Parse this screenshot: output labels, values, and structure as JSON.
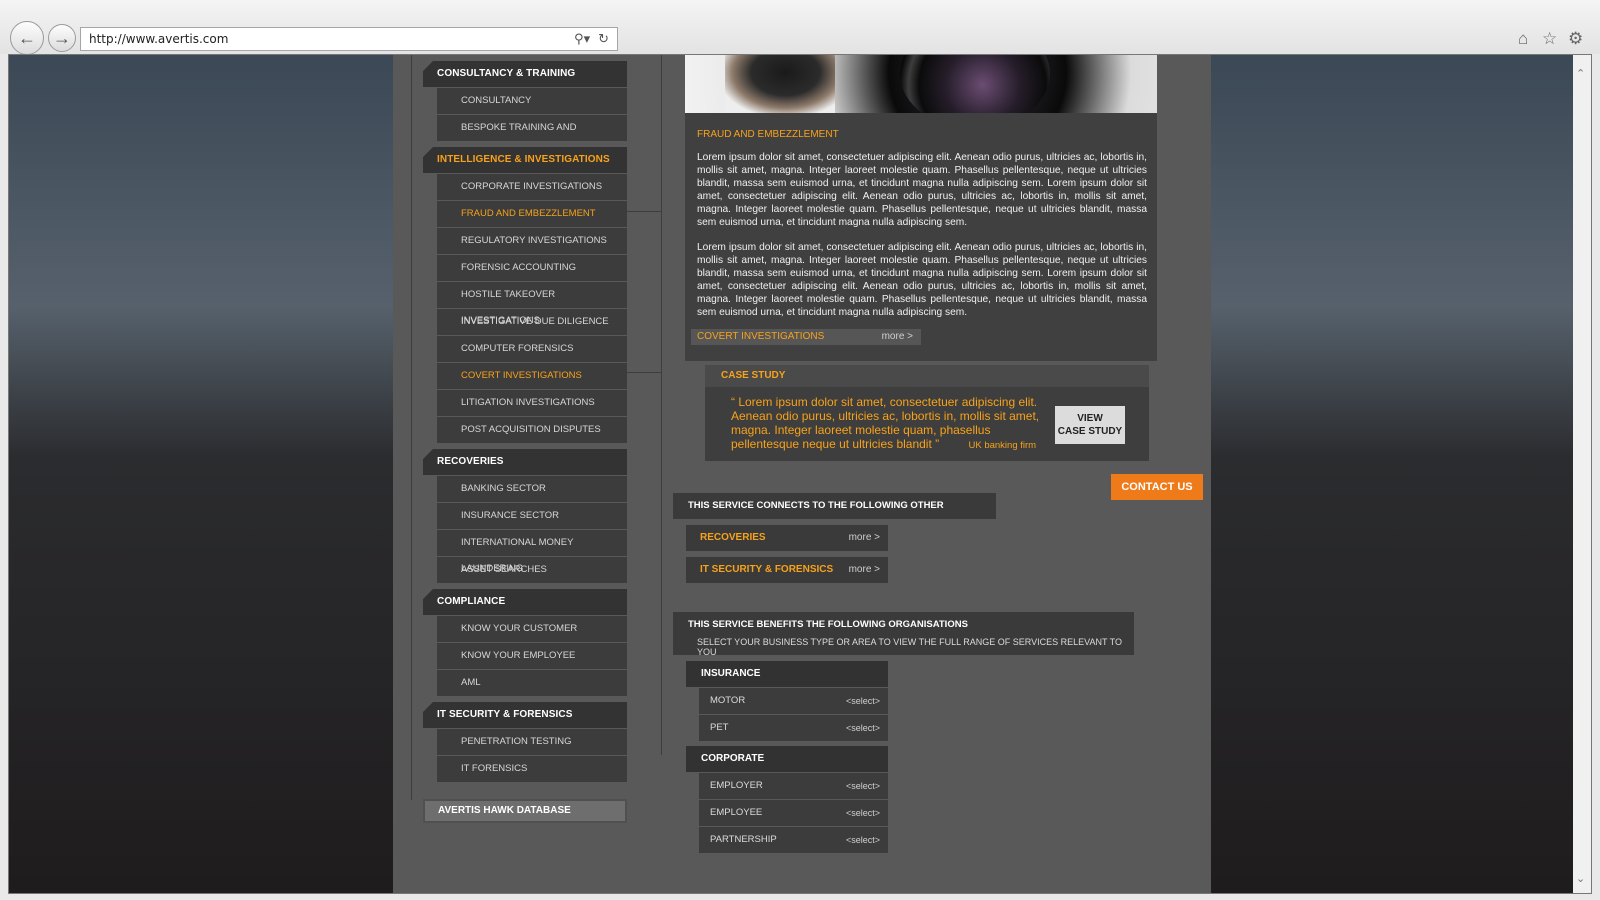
{
  "browser": {
    "url": "http://www.avertis.com",
    "icons": [
      "back-arrow-icon",
      "forward-arrow-icon",
      "search-icon",
      "refresh-icon",
      "home-icon",
      "star-icon",
      "gear-icon"
    ]
  },
  "colors": {
    "accent": "#f7a21b",
    "contact": "#ef7a1a",
    "panel": "#3a3a3a",
    "page": "#595959"
  },
  "menu": {
    "categories": [
      {
        "label": "CONSULTANCY & TRAINING",
        "items": [
          "CONSULTANCY",
          "BESPOKE TRAINING AND AWARENESS"
        ]
      },
      {
        "label": "INTELLIGENCE & INVESTIGATIONS",
        "items": [
          "CORPORATE INVESTIGATIONS",
          "FRAUD AND EMBEZZLEMENT",
          "REGULATORY INVESTIGATIONS",
          "FORENSIC ACCOUNTING",
          "HOSTILE TAKEOVER INVESTIGATIONS",
          "INVESTIGATIVE DUE DILIGENCE",
          "COMPUTER FORENSICS",
          "COVERT INVESTIGATIONS",
          "LITIGATION INVESTIGATIONS",
          "POST ACQUISITION DISPUTES"
        ]
      },
      {
        "label": "RECOVERIES",
        "items": [
          "BANKING SECTOR",
          "INSURANCE SECTOR",
          "INTERNATIONAL MONEY LAUNDERING",
          "ASSET SEARCHES"
        ]
      },
      {
        "label": "COMPLIANCE",
        "items": [
          "KNOW YOUR CUSTOMER",
          "KNOW YOUR EMPLOYEE",
          "AML"
        ]
      },
      {
        "label": "IT SECURITY & FORENSICS",
        "items": [
          "PENETRATION TESTING",
          "IT FORENSICS"
        ]
      }
    ],
    "hawk": "AVERTIS HAWK DATABASE"
  },
  "article": {
    "title": "FRAUD AND EMBEZZLEMENT",
    "p1": "Lorem ipsum dolor sit amet, consectetuer adipiscing elit. Aenean odio purus, ultricies ac, lobortis in, mollis sit amet, magna. Integer laoreet molestie quam. Phasellus pellentesque, neque ut ultricies blandit, massa sem euismod urna, et tincidunt magna nulla adipiscing sem. Lorem ipsum dolor sit amet, consectetuer adipiscing elit. Aenean odio purus, ultricies ac, lobortis in, mollis sit amet, magna. Integer laoreet molestie quam. Phasellus pellentesque, neque ut ultricies blandit, massa sem euismod urna, et tincidunt magna nulla adipiscing sem.",
    "p2": "Lorem ipsum dolor sit amet, consectetuer adipiscing elit. Aenean odio purus, ultricies ac, lobortis in, mollis sit amet, magna. Integer laoreet molestie quam. Phasellus pellentesque, neque ut ultricies blandit, massa sem euismod urna, et tincidunt magna nulla adipiscing sem. Lorem ipsum dolor sit amet, consectetuer adipiscing elit. Aenean odio purus, ultricies ac, lobortis in, mollis sit amet, magna. Integer laoreet molestie quam. Phasellus pellentesque, neque ut ultricies blandit, massa sem euismod urna, et tincidunt magna nulla adipiscing sem.",
    "related_label": "COVERT INVESTIGATIONS",
    "related_more": "more >"
  },
  "case_study": {
    "tab": "CASE STUDY",
    "quote": "“ Lorem ipsum dolor sit amet, consectetuer adipiscing elit. Aenean odio purus, ultricies ac, lobortis in, mollis sit amet, magna. Integer laoreet molestie quam, phasellus pellentesque neque ut ultricies blandit ”",
    "firm": "UK banking firm",
    "button_line1": "VIEW",
    "button_line2": "CASE STUDY"
  },
  "contact_label": "CONTACT US",
  "connects": {
    "title": "THIS SERVICE CONNECTS TO THE FOLLOWING OTHER SERVICES:",
    "services": [
      {
        "name": "RECOVERIES",
        "more": "more >"
      },
      {
        "name": "IT SECURITY & FORENSICS",
        "more": "more >"
      }
    ]
  },
  "benefits": {
    "title": "THIS SERVICE BENEFITS THE FOLLOWING ORGANISATIONS",
    "subtitle": "SELECT YOUR BUSINESS TYPE OR AREA TO VIEW THE FULL RANGE OF SERVICES RELEVANT TO YOU",
    "groups": [
      {
        "name": "INSURANCE",
        "items": [
          {
            "label": "MOTOR",
            "select": "<select>"
          },
          {
            "label": "PET",
            "select": "<select>"
          }
        ]
      },
      {
        "name": "CORPORATE",
        "items": [
          {
            "label": "EMPLOYER",
            "select": "<select>"
          },
          {
            "label": "EMPLOYEE",
            "select": "<select>"
          },
          {
            "label": "PARTNERSHIP",
            "select": "<select>"
          }
        ]
      }
    ]
  }
}
